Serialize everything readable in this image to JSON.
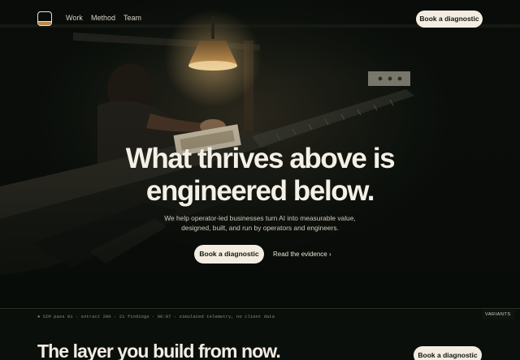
{
  "nav": {
    "links": [
      "Work",
      "Method",
      "Team"
    ],
    "cta": "Book a diagnostic"
  },
  "hero": {
    "headline_line1": "What thrives above is",
    "headline_line2": "engineered below.",
    "sub_line1": "We help operator-led businesses turn AI into measurable value,",
    "sub_line2": "designed, built, and run by operators and engineers.",
    "primary_cta": "Book a diagnostic",
    "secondary_cta": "Read the evidence ›"
  },
  "telemetry": {
    "dot": "●",
    "text": " SIM  pass 01  ·  extract 200  ·  21 findings  ·  00:07  ·  simulated telemetry, no client data"
  },
  "variants_label": "VARIANTS",
  "section": {
    "title": "The layer you build from now.",
    "cta": "Book a diagnostic"
  },
  "colors": {
    "background": "#0b0f0b",
    "cta_fill": "#f2ede0",
    "lamp_glow": "#e6b36a",
    "telemetry_accent": "#5f9c62"
  }
}
